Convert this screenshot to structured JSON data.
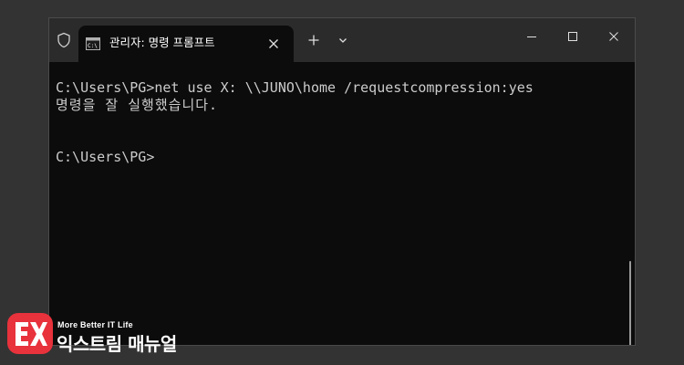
{
  "window": {
    "tab_title": "관리자: 명령 프롬프트"
  },
  "terminal": {
    "lines": [
      "C:\\Users\\PG>net use X: \\\\JUNO\\home /requestcompression:yes",
      "명령을 잘 실행했습니다.",
      "C:\\Users\\PG>"
    ]
  },
  "watermark": {
    "tagline": "More Better IT Life",
    "name": "익스트림 매뉴얼"
  },
  "icons": {
    "shield": "shield-icon",
    "tab": "command-prompt-icon",
    "tab_close": "close-icon",
    "new_tab": "plus-icon",
    "dropdown": "chevron-down-icon",
    "minimize": "minimize-icon",
    "maximize": "maximize-icon",
    "close": "close-icon"
  },
  "colors": {
    "background": "#333333",
    "titlebar": "#2b2b2b",
    "terminal_bg": "#0c0c0c",
    "terminal_text": "#cccccc",
    "logo_red": "#e8323c"
  }
}
